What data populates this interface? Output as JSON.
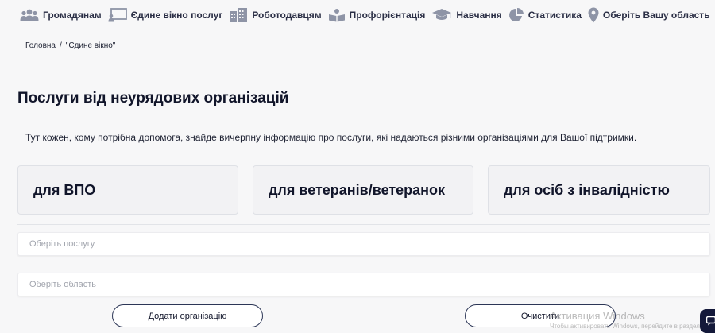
{
  "nav": {
    "items": [
      {
        "label": "Громадянам",
        "icon": "people-icon"
      },
      {
        "label": "Єдине вікно послуг",
        "icon": "presentation-board-icon"
      },
      {
        "label": "Роботодавцям",
        "icon": "buildings-icon"
      },
      {
        "label": "Профорієнтація",
        "icon": "open-book-icon"
      },
      {
        "label": "Навчання",
        "icon": "graduation-cap-icon"
      },
      {
        "label": "Статистика",
        "icon": "pie-chart-icon"
      },
      {
        "label": "Оберіть Вашу область",
        "icon": "map-pin-icon"
      }
    ],
    "icon_color": "#8e94a6"
  },
  "breadcrumb": {
    "home": "Головна",
    "separator": "/",
    "current": "\"Єдине вікно\""
  },
  "page": {
    "title": "Послуги від неурядових організацій",
    "intro": "Тут кожен, кому потрібна допомога, знайде вичерпну інформацію про послуги, які надаються різними організаціями для Вашої підтримки."
  },
  "categories": [
    {
      "label": "для ВПО"
    },
    {
      "label": "для ветеранів/ветеранок"
    },
    {
      "label": "для осіб з інвалідністю"
    }
  ],
  "filters": {
    "service_placeholder": "Оберіть послугу",
    "region_placeholder": "Оберіть область"
  },
  "actions": {
    "add_label": "Додати організацію",
    "clear_label": "Очистити",
    "border_color": "#2c3656"
  },
  "os_overlay": {
    "watermark": "Активация Windows",
    "watermark_sub": "Чтобы активировать Windows, перейдите в раздел \"Параметры\"."
  },
  "colors": {
    "background": "#f7f7f8",
    "text": "#11152a",
    "placeholder": "#a2a5ae",
    "card_bg": "#f2f2f4",
    "chat_widget": "#14193a"
  }
}
